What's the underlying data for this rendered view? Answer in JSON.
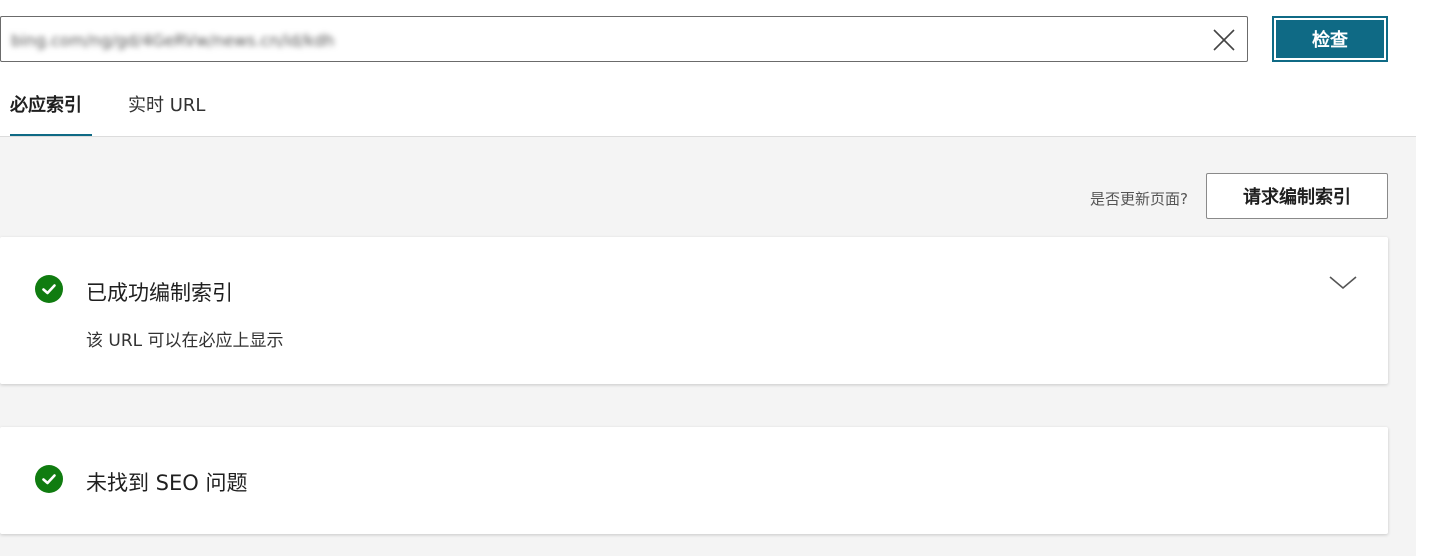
{
  "search": {
    "value": "bing.com/ng/gd/4GeRVw/news.cn/id/kdh",
    "check_label": "检查"
  },
  "tabs": [
    {
      "label": "必应索引",
      "active": true
    },
    {
      "label": "实时 URL",
      "active": false
    }
  ],
  "toolbar": {
    "update_question": "是否更新页面?",
    "request_label": "请求编制索引"
  },
  "cards": [
    {
      "status": "success",
      "title": "已成功编制索引",
      "subtitle": "该 URL 可以在必应上显示",
      "icon": "check-circle-icon"
    },
    {
      "status": "success",
      "title": "未找到 SEO 问题",
      "icon": "check-circle-icon"
    }
  ],
  "colors": {
    "accent": "#0f6a85",
    "success": "#107c10",
    "content_bg": "#f4f4f4"
  }
}
